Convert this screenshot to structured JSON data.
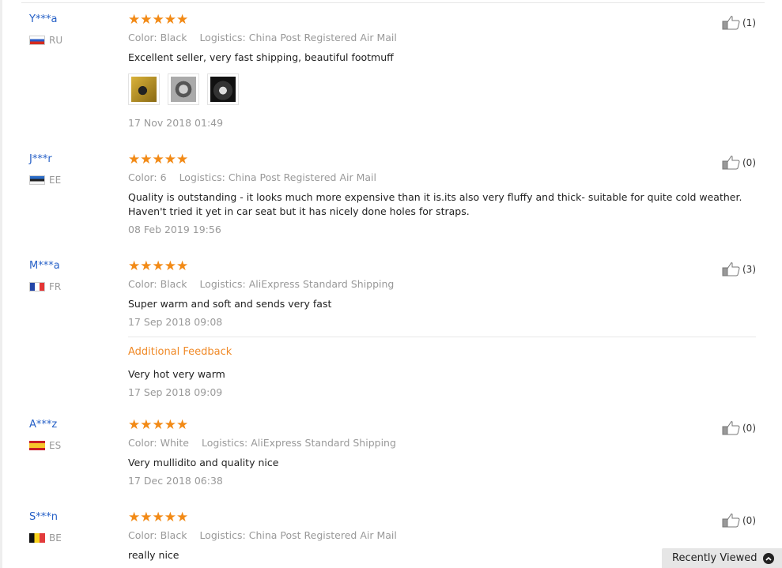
{
  "reviews": [
    {
      "user": "Y***a",
      "country_code": "RU",
      "stars": "★★★★★",
      "color_label": "Color:",
      "color_value": "Black",
      "logistics_label": "Logistics:",
      "logistics_value": "China Post Registered Air Mail",
      "text": "Excellent seller, very fast shipping, beautiful footmuff",
      "date": "17 Nov 2018 01:49",
      "likes": "(1)"
    },
    {
      "user": "J***r",
      "country_code": "EE",
      "stars": "★★★★★",
      "color_label": "Color:",
      "color_value": "6",
      "logistics_label": "Logistics:",
      "logistics_value": "China Post Registered Air Mail",
      "text": "Quality is outstanding - it looks much more expensive than it is.its also very fluffy and thick- suitable for quite cold weather. Haven't tried it yet in car seat but it has nicely done holes for straps.",
      "date": "08 Feb 2019 19:56",
      "likes": "(0)"
    },
    {
      "user": "M***a",
      "country_code": "FR",
      "stars": "★★★★★",
      "color_label": "Color:",
      "color_value": "Black",
      "logistics_label": "Logistics:",
      "logistics_value": "AliExpress Standard Shipping",
      "text": "Super warm and soft and sends very fast",
      "date": "17 Sep 2018 09:08",
      "additional_label": "Additional Feedback",
      "additional_text": "Very hot very warm",
      "additional_date": "17 Sep 2018 09:09",
      "likes": "(3)"
    },
    {
      "user": "A***z",
      "country_code": "ES",
      "stars": "★★★★★",
      "color_label": "Color:",
      "color_value": "White",
      "logistics_label": "Logistics:",
      "logistics_value": "AliExpress Standard Shipping",
      "text": "Very mullidito and quality nice",
      "date": "17 Dec 2018 06:38",
      "likes": "(0)"
    },
    {
      "user": "S***n",
      "country_code": "BE",
      "stars": "★★★★★",
      "color_label": "Color:",
      "color_value": "Black",
      "logistics_label": "Logistics:",
      "logistics_value": "China Post Registered Air Mail",
      "text": "really nice",
      "likes": "(0)"
    }
  ],
  "recently_viewed": {
    "label": "Recently Viewed",
    "icon": "chevron-up-circle-icon"
  },
  "colors": {
    "star": "#f28a16",
    "username": "#2761c7",
    "additional_feedback": "#f08a28"
  }
}
